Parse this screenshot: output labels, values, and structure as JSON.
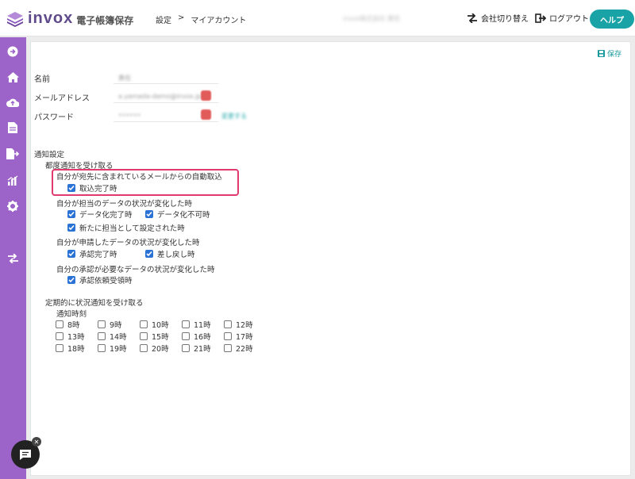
{
  "header": {
    "logo_text": "invox",
    "logo_sub": "電子帳簿保存",
    "breadcrumb": [
      "設定",
      ">",
      "マイアカウント"
    ],
    "user": "invox株式会社 責任",
    "switch_company": "会社切り替え",
    "logout": "ログアウト",
    "help": "ヘルプ"
  },
  "sidebar": {
    "icons": [
      "arrow-right-circle-icon",
      "home-icon",
      "cloud-upload-icon",
      "document-icon",
      "file-export-icon",
      "chart-icon",
      "gear-icon",
      "transfer-icon"
    ]
  },
  "content": {
    "save": "保存",
    "fields": {
      "name_label": "名前",
      "name_value": "責任",
      "email_label": "メールアドレス",
      "email_value": "a.yamada-demo@invox.jp",
      "password_label": "パスワード",
      "password_value": "••••••",
      "password_change": "変更する"
    },
    "notification": {
      "title": "通知設定",
      "each_title": "都度通知を受け取る",
      "auto_import_title": "自分が宛先に含まれているメールからの自動取込",
      "auto_import_done": "取込完了時",
      "assigned_title": "自分が担当のデータの状況が変化した時",
      "digitize_done": "データ化完了時",
      "digitize_failed": "データ化不可時",
      "new_assigned": "新たに担当として設定された時",
      "requested_title": "自分が申請したデータの状況が変化した時",
      "approved": "承認完了時",
      "returned": "差し戻し時",
      "approval_title": "自分の承認が必要なデータの状況が変化した時",
      "approval_received": "承認依頼受領時",
      "periodic_title": "定期的に状況通知を受け取る",
      "time_title": "通知時刻",
      "times": [
        "8時",
        "9時",
        "10時",
        "11時",
        "12時",
        "13時",
        "14時",
        "15時",
        "16時",
        "17時",
        "18時",
        "19時",
        "20時",
        "21時",
        "22時"
      ]
    }
  },
  "colors": {
    "brand_purple": "#9c64c8",
    "teal": "#1aa3a6",
    "checkbox_blue": "#2a72d4",
    "highlight_pink": "#e03a6f"
  }
}
